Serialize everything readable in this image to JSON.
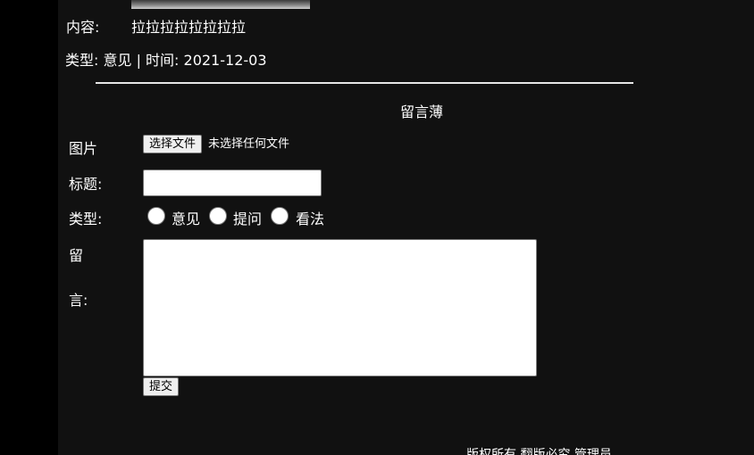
{
  "message": {
    "content_label": "内容:",
    "content_value": "拉拉拉拉拉拉拉拉",
    "meta": "类型: 意见 | 时间: 2021-12-03"
  },
  "guestbook": {
    "title": "留言薄",
    "image_label": "图片",
    "file_button": "选择文件",
    "file_status": "未选择任何文件",
    "title_label": "标题:",
    "title_value": "",
    "type_label": "类型:",
    "type_options": [
      "意见",
      "提问",
      "看法"
    ],
    "message_label_line1": "留",
    "message_label_line2": "言:",
    "message_value": "",
    "submit_label": "提交"
  },
  "footer": {
    "text": "版权所有 翻版必究 管理员"
  }
}
